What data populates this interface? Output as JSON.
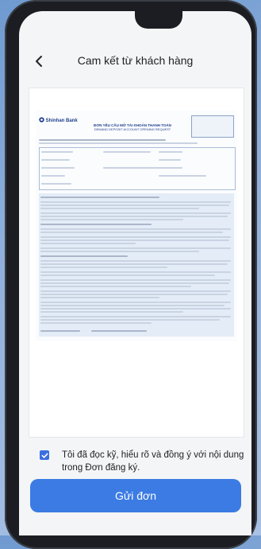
{
  "header": {
    "title": "Cam kết từ khách hàng"
  },
  "document": {
    "logo_text": "Shinhan Bank",
    "form_title": "ĐƠN YÊU CẦU MỞ TÀI KHOẢN THANH TOÁN",
    "form_subtitle": "DEMAND DEPOSIT ACCOUNT OPENING REQUEST"
  },
  "agreement": {
    "checked": true,
    "text": "Tôi đã đọc kỹ, hiểu rõ và đồng ý với nội dung trong Đơn đăng ký."
  },
  "actions": {
    "submit_label": "Gửi đơn"
  },
  "colors": {
    "accent": "#3b7be3",
    "checkbox": "#3a6fe0",
    "brand": "#1d3e8c"
  },
  "icons": {
    "back": "chevron-left-icon",
    "check": "checkmark-icon",
    "logo": "shinhan-logo-icon"
  }
}
